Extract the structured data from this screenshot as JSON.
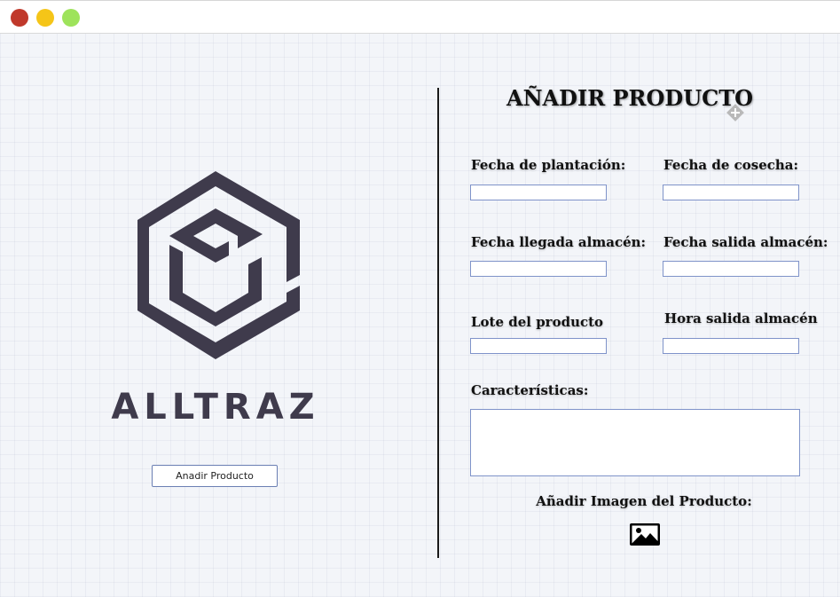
{
  "window": {
    "controls": [
      "close",
      "minimize",
      "maximize"
    ],
    "colors": {
      "close": "#c0392b",
      "minimize": "#f5c518",
      "maximize": "#9ee35b"
    }
  },
  "brand": {
    "name": "ALLTRAZ",
    "logo_icon": "hexagon-cube-logo",
    "color": "#3f3b4c"
  },
  "sidebar": {
    "add_button_label": "Anadir Producto"
  },
  "form": {
    "title": "AÑADIR PRODUCTO",
    "fields": {
      "planting_date": {
        "label": "Fecha de plantación:",
        "value": ""
      },
      "harvest_date": {
        "label": "Fecha de cosecha:",
        "value": ""
      },
      "warehouse_arrival_date": {
        "label": "Fecha llegada almacén:",
        "value": ""
      },
      "warehouse_exit_date": {
        "label": "Fecha salida almacén:",
        "value": ""
      },
      "product_lot": {
        "label": "Lote del producto",
        "value": ""
      },
      "warehouse_exit_time": {
        "label": "Hora salida almacén",
        "value": ""
      },
      "characteristics": {
        "label": "Características:",
        "value": ""
      }
    },
    "image_upload": {
      "label": "Añadir Imagen del Producto:",
      "icon": "image-icon"
    }
  }
}
